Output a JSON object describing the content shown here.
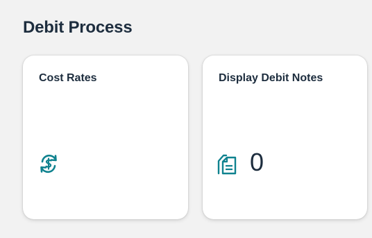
{
  "group": {
    "title": "Debit Process"
  },
  "tiles": [
    {
      "title": "Cost Rates",
      "icon": "currency-exchange-icon",
      "icon_color": "#0f828f"
    },
    {
      "title": "Display Debit Notes",
      "icon": "documents-icon",
      "icon_color": "#0f828f",
      "count": "0"
    }
  ],
  "colors": {
    "background": "#f2f2f2",
    "tile_background": "#ffffff",
    "title_text": "#1d2d3e",
    "icon_accent": "#0f828f"
  }
}
